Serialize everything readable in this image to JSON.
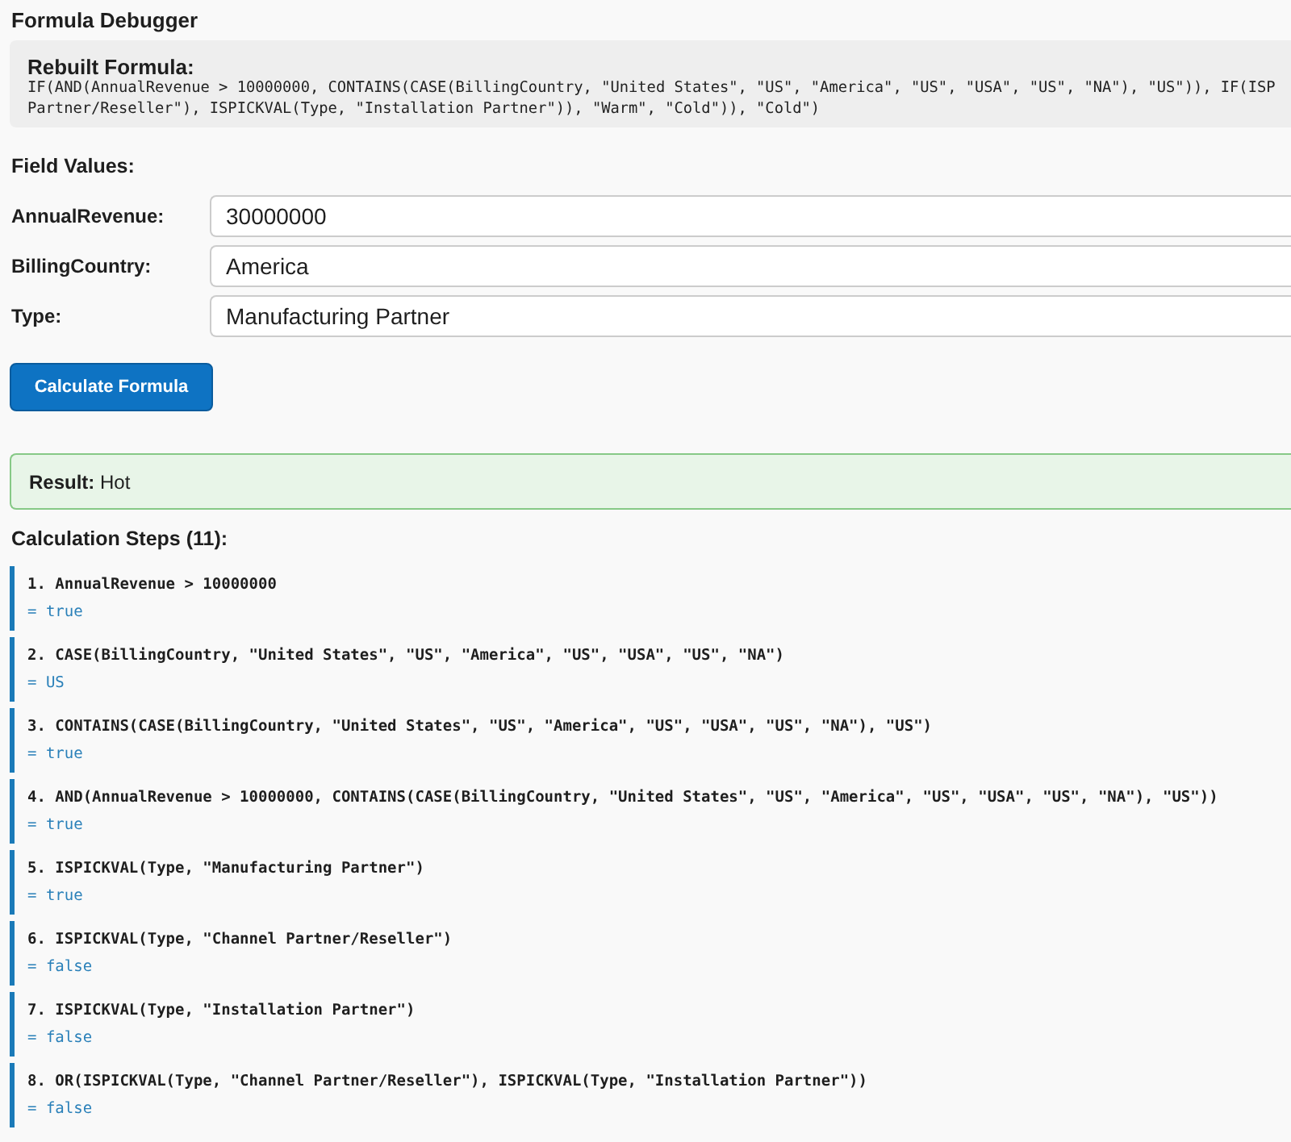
{
  "title": "Formula Debugger",
  "formula": {
    "label": "Rebuilt Formula:",
    "text": "IF(AND(AnnualRevenue > 10000000, CONTAINS(CASE(BillingCountry, \"United States\", \"US\", \"America\", \"US\", \"USA\", \"US\", \"NA\"), \"US\")), IF(ISP\nPartner/Reseller\"), ISPICKVAL(Type, \"Installation Partner\")), \"Warm\", \"Cold\")), \"Cold\")"
  },
  "fields_heading": "Field Values:",
  "fields": [
    {
      "label": "AnnualRevenue:",
      "value": "30000000"
    },
    {
      "label": "BillingCountry:",
      "value": "America"
    },
    {
      "label": "Type:",
      "value": "Manufacturing Partner"
    }
  ],
  "button": {
    "label": "Calculate Formula"
  },
  "result": {
    "text": "**Result:** Hot"
  },
  "steps_heading": "Calculation Steps (11):",
  "steps": [
    {
      "expression": "1. AnnualRevenue > 10000000",
      "result": "= true"
    },
    {
      "expression": "2. CASE(BillingCountry, \"United States\", \"US\", \"America\", \"US\", \"USA\", \"US\", \"NA\")",
      "result": "= US"
    },
    {
      "expression": "3. CONTAINS(CASE(BillingCountry, \"United States\", \"US\", \"America\", \"US\", \"USA\", \"US\", \"NA\"), \"US\")",
      "result": "= true"
    },
    {
      "expression": "4. AND(AnnualRevenue > 10000000, CONTAINS(CASE(BillingCountry, \"United States\", \"US\", \"America\", \"US\", \"USA\", \"US\", \"NA\"), \"US\"))",
      "result": "= true"
    },
    {
      "expression": "5. ISPICKVAL(Type, \"Manufacturing Partner\")",
      "result": "= true"
    },
    {
      "expression": "6. ISPICKVAL(Type, \"Channel Partner/Reseller\")",
      "result": "= false"
    },
    {
      "expression": "7. ISPICKVAL(Type, \"Installation Partner\")",
      "result": "= false"
    },
    {
      "expression": "8. OR(ISPICKVAL(Type, \"Channel Partner/Reseller\"), ISPICKVAL(Type, \"Installation Partner\"))",
      "result": "= false"
    }
  ]
}
